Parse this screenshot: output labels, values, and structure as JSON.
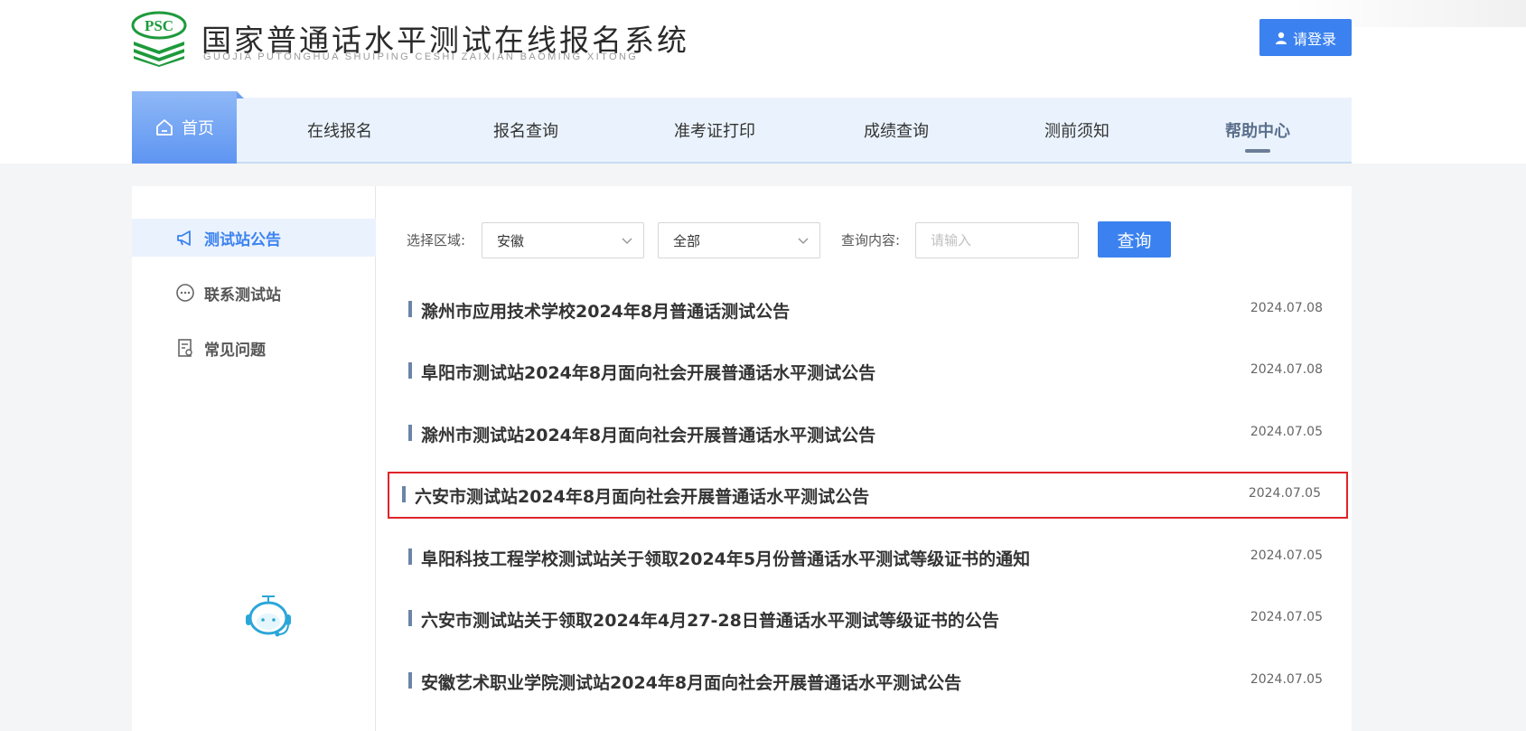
{
  "header": {
    "logo_abbr": "PSC",
    "title": "国家普通话水平测试在线报名系统",
    "subtitle": "GUOJIA PUTONGHUA SHUIPING CESHI ZAIXIAN BAOMING XITONG",
    "login_label": "请登录"
  },
  "nav": {
    "items": [
      {
        "label": "首页",
        "icon": "home-icon"
      },
      {
        "label": "在线报名"
      },
      {
        "label": "报名查询"
      },
      {
        "label": "准考证打印"
      },
      {
        "label": "成绩查询"
      },
      {
        "label": "测前须知"
      },
      {
        "label": "帮助中心"
      }
    ],
    "active_index": 6
  },
  "sidebar": {
    "items": [
      {
        "label": "测试站公告",
        "icon": "megaphone-icon",
        "active": true
      },
      {
        "label": "联系测试站",
        "icon": "chat-icon",
        "active": false
      },
      {
        "label": "常见问题",
        "icon": "document-icon",
        "active": false
      }
    ],
    "assistant_icon": "robot-assistant-icon"
  },
  "filters": {
    "region_label": "选择区域:",
    "province_value": "安徽",
    "city_value": "全部",
    "query_label": "查询内容:",
    "query_placeholder": "请输入",
    "query_button": "查询"
  },
  "notices": [
    {
      "title": "滁州市应用技术学校2024年8月普通话测试公告",
      "date": "2024.07.08",
      "highlighted": false
    },
    {
      "title": "阜阳市测试站2024年8月面向社会开展普通话水平测试公告",
      "date": "2024.07.08",
      "highlighted": false
    },
    {
      "title": "滁州市测试站2024年8月面向社会开展普通话水平测试公告",
      "date": "2024.07.05",
      "highlighted": false
    },
    {
      "title": "六安市测试站2024年8月面向社会开展普通话水平测试公告",
      "date": "2024.07.05",
      "highlighted": true
    },
    {
      "title": "阜阳科技工程学校测试站关于领取2024年5月份普通话水平测试等级证书的通知",
      "date": "2024.07.05",
      "highlighted": false
    },
    {
      "title": "六安市测试站关于领取2024年4月27-28日普通话水平测试等级证书的公告",
      "date": "2024.07.05",
      "highlighted": false
    },
    {
      "title": "安徽艺术职业学院测试站2024年8月面向社会开展普通话水平测试公告",
      "date": "2024.07.05",
      "highlighted": false
    }
  ],
  "colors": {
    "accent": "#3b82f0",
    "nav_bg": "#eaf3fd",
    "highlight_border": "#e0242a",
    "logo_green": "#1e9a3c"
  }
}
